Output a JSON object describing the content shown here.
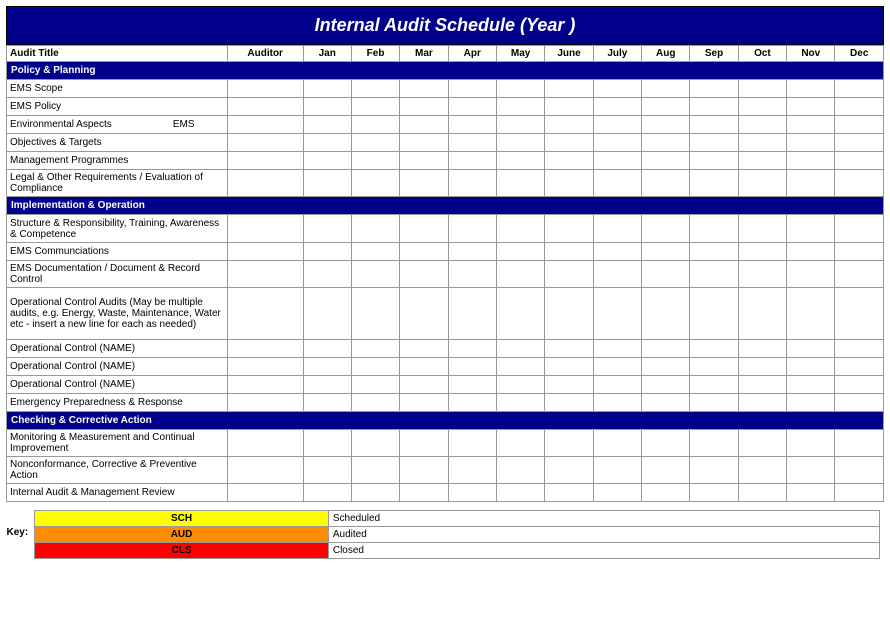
{
  "title": "Internal Audit Schedule (Year                )",
  "header": {
    "audit_title": "Audit Title",
    "auditor": "Auditor",
    "months": [
      "Jan",
      "Feb",
      "Mar",
      "Apr",
      "May",
      "June",
      "July",
      "Aug",
      "Sep",
      "Oct",
      "Nov",
      "Dec"
    ]
  },
  "sections": [
    {
      "label": "Policy & Planning",
      "rows": [
        {
          "label": "EMS Scope",
          "auditor": "",
          "months": [
            "",
            "",
            "",
            "",
            "",
            "",
            "",
            "",
            "",
            "",
            "",
            ""
          ]
        },
        {
          "label": "EMS Policy",
          "auditor": "",
          "months": [
            "",
            "",
            "",
            "",
            "",
            "",
            "",
            "",
            "",
            "",
            "",
            ""
          ]
        },
        {
          "label": "Environmental Aspects",
          "ems_note": "EMS",
          "auditor": "",
          "months": [
            "",
            "",
            "",
            "",
            "",
            "",
            "",
            "",
            "",
            "",
            "",
            ""
          ]
        },
        {
          "label": "Objectives & Targets",
          "auditor": "",
          "months": [
            "",
            "",
            "",
            "",
            "",
            "",
            "",
            "",
            "",
            "",
            "",
            ""
          ]
        },
        {
          "label": "Management Programmes",
          "auditor": "",
          "months": [
            "",
            "",
            "",
            "",
            "",
            "",
            "",
            "",
            "",
            "",
            "",
            ""
          ]
        },
        {
          "label": "Legal & Other Requirements / Evaluation of Compliance",
          "auditor": "",
          "months": [
            "",
            "",
            "",
            "",
            "",
            "",
            "",
            "",
            "",
            "",
            "",
            ""
          ],
          "tall": false,
          "extra_height": 22
        }
      ]
    },
    {
      "label": "Implementation & Operation",
      "rows": [
        {
          "label": "Structure & Responsibility, Training, Awareness & Competence",
          "auditor": "",
          "months": [
            "",
            "",
            "",
            "",
            "",
            "",
            "",
            "",
            "",
            "",
            "",
            ""
          ],
          "medium": true
        },
        {
          "label": "EMS Communciations",
          "auditor": "",
          "months": [
            "",
            "",
            "",
            "",
            "",
            "",
            "",
            "",
            "",
            "",
            "",
            ""
          ]
        },
        {
          "label": "EMS Documentation / Document & Record Control",
          "auditor": "",
          "months": [
            "",
            "",
            "",
            "",
            "",
            "",
            "",
            "",
            "",
            "",
            "",
            ""
          ]
        },
        {
          "label": "Operational Control Audits (May be multiple audits, e.g. Energy, Waste, Maintenance, Water etc - insert a new line for each as needed)",
          "auditor": "",
          "months": [
            "",
            "",
            "",
            "",
            "",
            "",
            "",
            "",
            "",
            "",
            "",
            ""
          ],
          "tall": true
        },
        {
          "label": "Operational Control (NAME)",
          "auditor": "",
          "months": [
            "",
            "",
            "",
            "",
            "",
            "",
            "",
            "",
            "",
            "",
            "",
            ""
          ]
        },
        {
          "label": "Operational Control (NAME)",
          "auditor": "",
          "months": [
            "",
            "",
            "",
            "",
            "",
            "",
            "",
            "",
            "",
            "",
            "",
            ""
          ]
        },
        {
          "label": "Operational Control (NAME)",
          "auditor": "",
          "months": [
            "",
            "",
            "",
            "",
            "",
            "",
            "",
            "",
            "",
            "",
            "",
            ""
          ]
        },
        {
          "label": "Emergency Preparedness & Response",
          "auditor": "",
          "months": [
            "",
            "",
            "",
            "",
            "",
            "",
            "",
            "",
            "",
            "",
            "",
            ""
          ]
        }
      ]
    },
    {
      "label": "Checking & Corrective Action",
      "rows": [
        {
          "label": "Monitoring & Measurement and Continual Improvement",
          "auditor": "",
          "months": [
            "",
            "",
            "",
            "",
            "",
            "",
            "",
            "",
            "",
            "",
            "",
            ""
          ]
        },
        {
          "label": "Nonconformance, Corrective & Preventive Action",
          "auditor": "",
          "months": [
            "",
            "",
            "",
            "",
            "",
            "",
            "",
            "",
            "",
            "",
            "",
            ""
          ]
        },
        {
          "label": "Internal Audit & Management Review",
          "auditor": "",
          "months": [
            "",
            "",
            "",
            "",
            "",
            "",
            "",
            "",
            "",
            "",
            "",
            ""
          ]
        }
      ]
    }
  ],
  "key": {
    "label": "Key:",
    "items": [
      {
        "code": "SCH",
        "label": "Scheduled",
        "color": "#FFFF00"
      },
      {
        "code": "AUD",
        "label": "Audited",
        "color": "#FF8C00"
      },
      {
        "code": "CLS",
        "label": "Closed",
        "color": "#FF0000"
      }
    ]
  }
}
